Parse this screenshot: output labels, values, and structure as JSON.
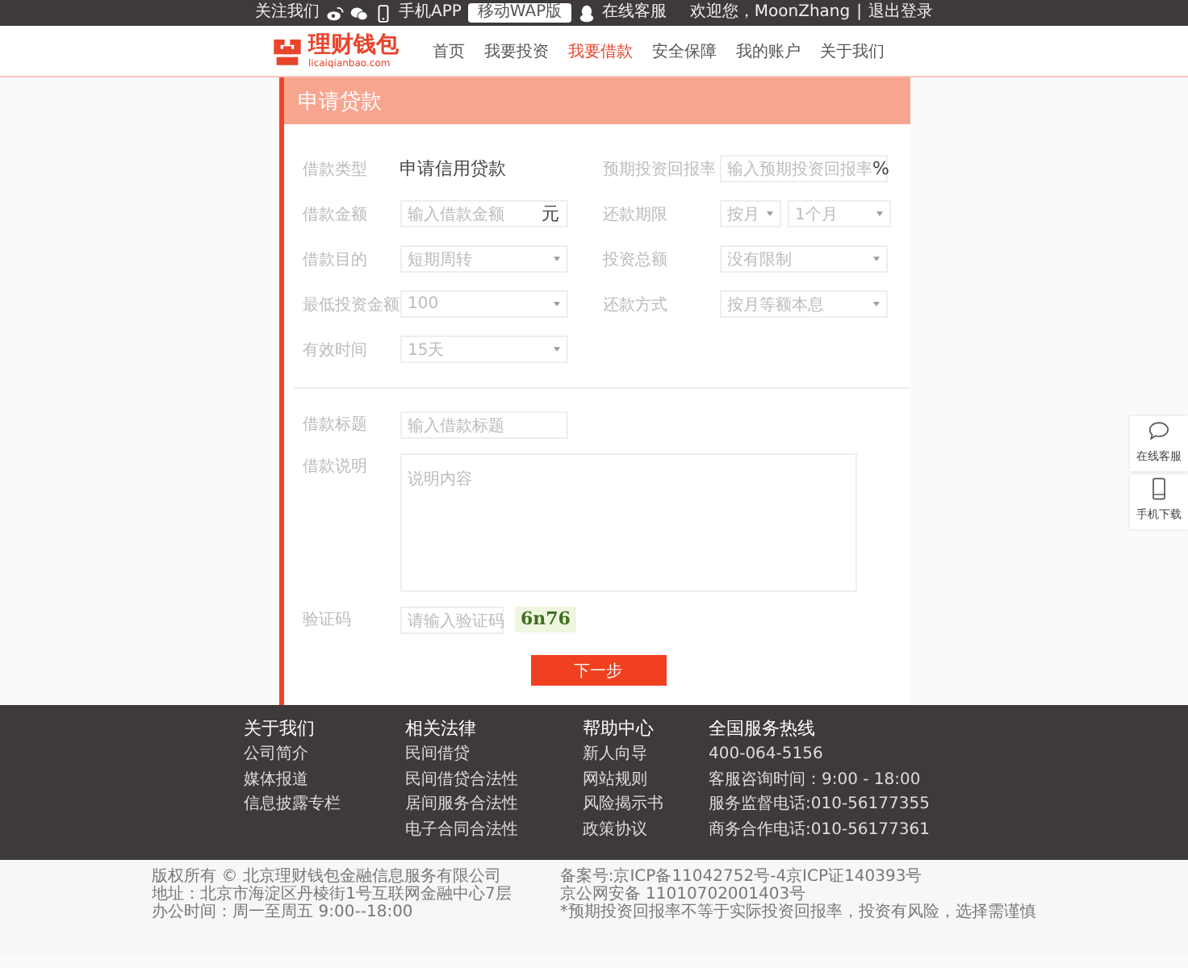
{
  "top_bar": {
    "follow": "关注我们",
    "app": "手机APP",
    "wap_button": "移动WAP版",
    "service": "在线客服",
    "greeting": "欢迎您，MoonZhang",
    "separator": "|",
    "logout": "退出登录"
  },
  "logo": {
    "name": "理财钱包",
    "domain": "licaiqianbao.com"
  },
  "nav": [
    {
      "label": "首页",
      "selected": false
    },
    {
      "label": "我要投资",
      "selected": false
    },
    {
      "label": "我要借款",
      "selected": true
    },
    {
      "label": "安全保障",
      "selected": false
    },
    {
      "label": "我的账户",
      "selected": false
    },
    {
      "label": "关于我们",
      "selected": false
    }
  ],
  "page_title": "申请贷款",
  "fields": [
    {
      "label": "借款类型",
      "kind": "static",
      "value": "申请信用贷款"
    },
    {
      "label": "预期投资回报率",
      "kind": "input",
      "placeholder": "输入预期投资回报率",
      "unit": "%"
    },
    {
      "label": "借款金额",
      "kind": "input",
      "placeholder": "输入借款金额",
      "unit": "元"
    },
    {
      "label": "还款期限",
      "kind": "select_pair",
      "values": [
        "按月",
        "1个月"
      ]
    },
    {
      "label": "借款目的",
      "kind": "select",
      "value": "短期周转"
    },
    {
      "label": "投资总额",
      "kind": "select",
      "value": "没有限制"
    },
    {
      "label": "最低投资金额",
      "kind": "select",
      "value": "100"
    },
    {
      "label": "还款方式",
      "kind": "select",
      "value": "按月等额本息"
    },
    {
      "label": "有效时间",
      "kind": "select",
      "value": "15天"
    }
  ],
  "details": [
    {
      "label": "借款标题",
      "kind": "input",
      "placeholder": "输入借款标题"
    },
    {
      "label": "借款说明",
      "kind": "textarea",
      "placeholder": "说明内容"
    },
    {
      "label": "验证码",
      "kind": "captcha",
      "placeholder": "请输入验证码",
      "code": "6n76"
    }
  ],
  "submit": "下一步",
  "footer_columns": [
    {
      "title": "关于我们",
      "links": [
        "公司简介",
        "媒体报道",
        "信息披露专栏"
      ]
    },
    {
      "title": "相关法律",
      "links": [
        "民间借贷",
        "民间借贷合法性",
        "居间服务合法性",
        "电子合同合法性"
      ]
    },
    {
      "title": "帮助中心",
      "links": [
        "新人向导",
        "网站规则",
        "风险揭示书",
        "政策协议"
      ]
    },
    {
      "title": "全国服务热线",
      "links": [
        "400-064-5156",
        "客服咨询时间：9:00 - 18:00",
        "服务监督电话:010-56177355",
        "商务合作电话:010-56177361"
      ]
    }
  ],
  "bottom_left": [
    "版权所有 © 北京理财钱包金融信息服务有限公司",
    "地址：北京市海淀区丹棱街1号互联网金融中心7层",
    "办公时间：周一至周五 9:00--18:00"
  ],
  "bottom_right": [
    "备案号:京ICP备11042752号-4京ICP证140393号",
    "京公网安备 11010702001403号",
    "*预期投资回报率不等于实际投资回报率，投资有风险，选择需谨慎"
  ],
  "side_widgets": [
    {
      "kind": "chat",
      "label": "在线客服"
    },
    {
      "kind": "phone",
      "label": "手机下载"
    }
  ]
}
